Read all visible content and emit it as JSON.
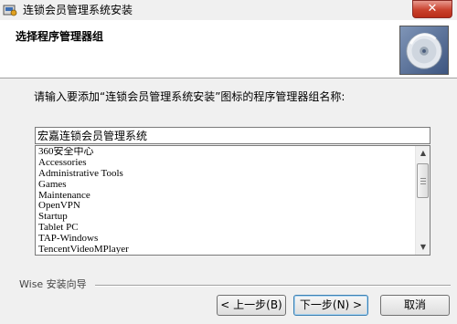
{
  "window": {
    "title": "连锁会员管理系统安装",
    "close_label": "✕"
  },
  "header": {
    "title": "选择程序管理器组"
  },
  "prompt": "请输入要添加“连锁会员管理系统安装”图标的程序管理器组名称:",
  "group_name_input": {
    "value": "宏嘉连锁会员管理系统"
  },
  "group_list": [
    "360安全中心",
    "Accessories",
    "Administrative Tools",
    "Games",
    "Maintenance",
    "OpenVPN",
    "Startup",
    "Tablet PC",
    "TAP-Windows",
    "TencentVideoMPlayer"
  ],
  "footer": {
    "wizard_label": "Wise 安装向导"
  },
  "buttons": {
    "back": "< 上一步(B)",
    "next": "下一步(N) >",
    "cancel": "取消"
  },
  "icons": {
    "app": "installer-icon",
    "header": "cd-disc-icon"
  }
}
